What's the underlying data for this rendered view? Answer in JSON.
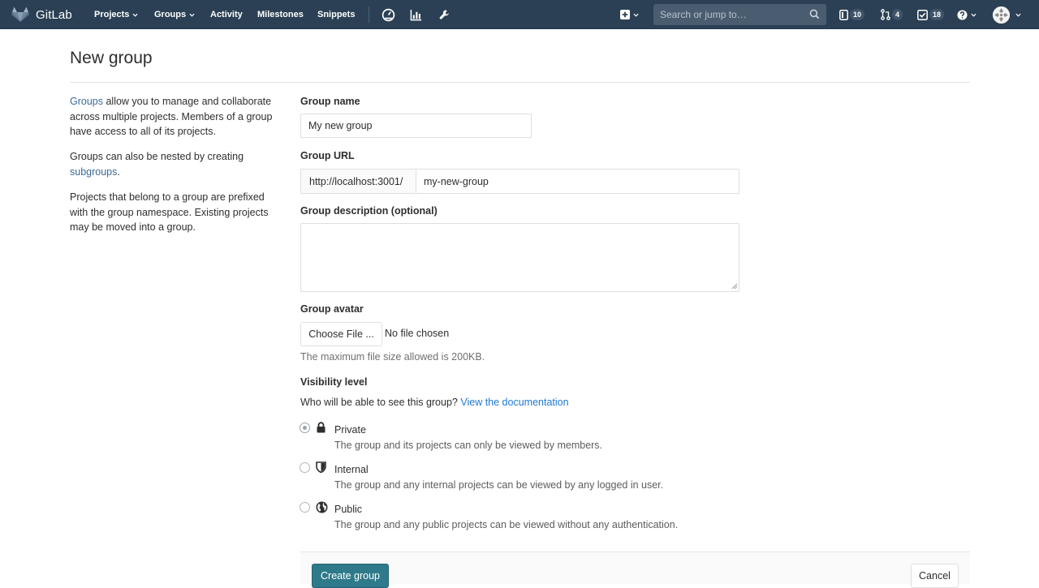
{
  "navbar": {
    "brand": "GitLab",
    "menu": [
      {
        "label": "Projects",
        "dropdown": true
      },
      {
        "label": "Groups",
        "dropdown": true
      },
      {
        "label": "Activity",
        "dropdown": false
      },
      {
        "label": "Milestones",
        "dropdown": false
      },
      {
        "label": "Snippets",
        "dropdown": false
      }
    ],
    "tool_icons": [
      "dashboard-gauge-icon",
      "bar-chart-icon",
      "wrench-icon"
    ],
    "new_icon": "plus-square-icon",
    "search_placeholder": "Search or jump to…",
    "counters": [
      {
        "icon": "issues-icon",
        "count": "10"
      },
      {
        "icon": "merge-request-icon",
        "count": "4"
      },
      {
        "icon": "todo-check-icon",
        "count": "18"
      }
    ],
    "help_icon": "question-circle-icon",
    "bg_color": "#2b4054"
  },
  "page": {
    "title": "New group"
  },
  "sidebar": {
    "p1_link": "Groups",
    "p1_text": " allow you to manage and collaborate across multiple projects. Members of a group have access to all of its projects.",
    "p2_text": "Groups can also be nested by creating ",
    "p2_link": "subgroups",
    "p2_end": ".",
    "p3_text": "Projects that belong to a group are prefixed with the group namespace. Existing projects may be moved into a group."
  },
  "form": {
    "group_name_label": "Group name",
    "group_name_value": "My new group",
    "group_url_label": "Group URL",
    "url_prefix": "http://localhost:3001/",
    "url_path_value": "my-new-group",
    "description_label": "Group description (optional)",
    "description_value": "",
    "avatar_label": "Group avatar",
    "choose_file_label": "Choose File ...",
    "no_file_text": "No file chosen",
    "avatar_help": "The maximum file size allowed is 200KB.",
    "visibility_label": "Visibility level",
    "visibility_question": "Who will be able to see this group?",
    "visibility_doc_link": "View the documentation",
    "visibility_options": [
      {
        "title": "Private",
        "icon": "lock-icon",
        "checked": true,
        "description": "The group and its projects can only be viewed by members."
      },
      {
        "title": "Internal",
        "icon": "shield-icon",
        "checked": false,
        "description": "The group and any internal projects can be viewed by any logged in user."
      },
      {
        "title": "Public",
        "icon": "globe-icon",
        "checked": false,
        "description": "The group and any public projects can be viewed without any authentication."
      }
    ],
    "create_button": "Create group",
    "cancel_button": "Cancel",
    "accent_color": "#2f7a8a",
    "link_color": "#1f78d1"
  }
}
